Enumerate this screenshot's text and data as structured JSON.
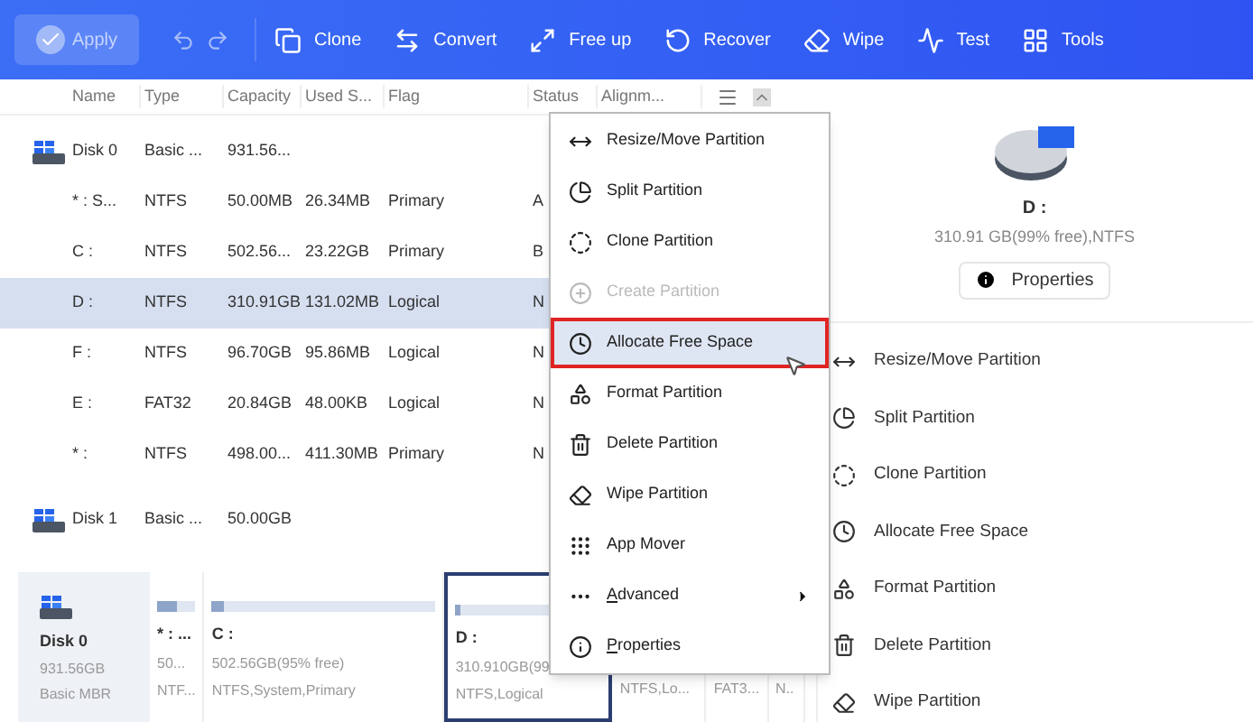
{
  "toolbar": {
    "apply": {
      "label": "Apply",
      "disabled": true
    },
    "buttons": [
      {
        "label": "Clone"
      },
      {
        "label": "Convert"
      },
      {
        "label": "Free up"
      },
      {
        "label": "Recover"
      },
      {
        "label": "Wipe"
      },
      {
        "label": "Test"
      },
      {
        "label": "Tools"
      }
    ]
  },
  "table": {
    "columns": [
      "Name",
      "Type",
      "Capacity",
      "Used S...",
      "Flag",
      "Status",
      "Alignm..."
    ],
    "rows": [
      {
        "kind": "disk",
        "selected": false,
        "cells": [
          "Disk 0",
          "Basic ...",
          "931.56..."
        ]
      },
      {
        "kind": "partition",
        "selected": false,
        "cells": [
          "* : S...",
          "NTFS",
          "50.00MB",
          "26.34MB",
          "Primary",
          "A"
        ]
      },
      {
        "kind": "partition",
        "selected": false,
        "cells": [
          "C :",
          "NTFS",
          "502.56...",
          "23.22GB",
          "Primary",
          "B"
        ]
      },
      {
        "kind": "partition",
        "selected": true,
        "cells": [
          "D :",
          "NTFS",
          "310.91GB",
          "131.02MB",
          "Logical",
          "N"
        ]
      },
      {
        "kind": "partition",
        "selected": false,
        "cells": [
          "F :",
          "NTFS",
          "96.70GB",
          "95.86MB",
          "Logical",
          "N"
        ]
      },
      {
        "kind": "partition",
        "selected": false,
        "cells": [
          "E :",
          "FAT32",
          "20.84GB",
          "48.00KB",
          "Logical",
          "N"
        ]
      },
      {
        "kind": "partition",
        "selected": false,
        "cells": [
          "* :",
          "NTFS",
          "498.00...",
          "411.30MB",
          "Primary",
          "N"
        ]
      },
      {
        "kind": "disk",
        "selected": false,
        "cells": [
          "Disk 1",
          "Basic ...",
          "50.00GB"
        ]
      }
    ]
  },
  "context_menu": [
    {
      "label": "Resize/Move Partition",
      "kind": "item",
      "disabled": false,
      "selected": false
    },
    {
      "label": "Split Partition",
      "kind": "item",
      "disabled": false,
      "selected": false
    },
    {
      "label": "Clone Partition",
      "kind": "item",
      "disabled": false,
      "selected": false
    },
    {
      "label": "Create Partition",
      "kind": "item",
      "disabled": true,
      "selected": false
    },
    {
      "label": "Allocate Free Space",
      "kind": "item",
      "disabled": false,
      "selected": true
    },
    {
      "label": "Format Partition",
      "kind": "item",
      "disabled": false,
      "selected": false
    },
    {
      "label": "Delete Partition",
      "kind": "item",
      "disabled": false,
      "selected": false
    },
    {
      "label": "Wipe Partition",
      "kind": "item",
      "disabled": false,
      "selected": false
    },
    {
      "label": "App Mover",
      "kind": "item",
      "disabled": false,
      "selected": false
    },
    {
      "label": "Advanced",
      "kind": "submenu",
      "mnemonic": true,
      "disabled": false,
      "selected": false
    },
    {
      "label": "Properties",
      "kind": "item",
      "mnemonic": true,
      "disabled": false,
      "selected": false
    }
  ],
  "details": {
    "name": "D :",
    "info": "310.91 GB(99% free),NTFS",
    "button": "Properties",
    "actions": [
      {
        "label": "Resize/Move Partition"
      },
      {
        "label": "Split Partition"
      },
      {
        "label": "Clone Partition"
      },
      {
        "label": "Allocate Free Space"
      },
      {
        "label": "Format Partition"
      },
      {
        "label": "Delete Partition"
      },
      {
        "label": "Wipe Partition"
      }
    ]
  },
  "disk_map": {
    "disk": {
      "name": "Disk 0",
      "size": "931.56GB",
      "type": "Basic MBR"
    },
    "partitions": [
      {
        "name": "* : ...",
        "size": "50...",
        "info": "NTF...",
        "level": 0.5,
        "selected": false
      },
      {
        "name": "C :",
        "size": "502.56GB(95% free)",
        "info": "NTFS,System,Primary",
        "level": 0.05,
        "selected": false
      },
      {
        "name": "D :",
        "size": "310.910GB(99",
        "info": "NTFS,Logical",
        "level": 0.01,
        "selected": true
      },
      {
        "info": "NTFS,Lo...",
        "selected": false
      },
      {
        "info": "FAT3...",
        "selected": false
      },
      {
        "info": "N..",
        "selected": false
      }
    ]
  }
}
